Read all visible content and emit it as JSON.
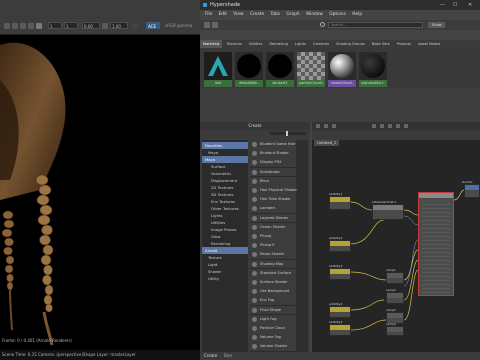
{
  "viewport": {
    "size_w": "1",
    "size_h": "1",
    "exposure": "0.00",
    "gamma": "1.00",
    "aces_badge": "ACE",
    "colorspace": "sRGB gamma",
    "footer_status": "Frame: 0 / 0.401   (Arnold Renderer)",
    "footer_camera": "Scene Time: 6.15   Camera: (perspective)Shape   Layer: masterLayer"
  },
  "hypershade": {
    "title": "Hypershade",
    "menus": [
      "File",
      "Edit",
      "View",
      "Create",
      "Tabs",
      "Graph",
      "Window",
      "Options",
      "Help"
    ],
    "search_placeholder": "Search...",
    "show_button": "Show",
    "browser_tabs": [
      "Materials",
      "Textures",
      "Utilities",
      "Rendering",
      "Lights",
      "Cameras",
      "Shading Groups",
      "Bake Sets",
      "Projects",
      "Asset Nodes"
    ],
    "swatches": [
      {
        "label": "Hair",
        "icon": "arnold-logo-icon",
        "color": "#2aa6b3"
      },
      {
        "label": "defaultMat..",
        "icon": "black-sphere-icon",
        "color": "#000000"
      },
      {
        "label": "lambert1",
        "icon": "black-sphere-icon",
        "color": "#000000"
      },
      {
        "label": "particleCloud1",
        "icon": "checker-icon",
        "color": "#888888"
      },
      {
        "label": "shaderGlow1",
        "icon": "glow-sphere-icon",
        "color": "#bfbfbf"
      },
      {
        "label": "standardSurf..",
        "icon": "dark-sphere-icon",
        "color": "#1a1a1a"
      }
    ],
    "create": {
      "title": "Create",
      "tree": [
        {
          "label": "Favorites",
          "group": true
        },
        {
          "label": "Maya",
          "group": false,
          "indent": 1
        },
        {
          "label": "Maya",
          "group": true
        },
        {
          "label": "Surface",
          "group": false,
          "indent": 2
        },
        {
          "label": "Volumetric",
          "group": false,
          "indent": 2
        },
        {
          "label": "Displacement",
          "group": false,
          "indent": 2
        },
        {
          "label": "2D Textures",
          "group": false,
          "indent": 2
        },
        {
          "label": "3D Textures",
          "group": false,
          "indent": 2
        },
        {
          "label": "Env Textures",
          "group": false,
          "indent": 2
        },
        {
          "label": "Other Textures",
          "group": false,
          "indent": 2
        },
        {
          "label": "Lights",
          "group": false,
          "indent": 2
        },
        {
          "label": "Utilities",
          "group": false,
          "indent": 2
        },
        {
          "label": "Image Planes",
          "group": false,
          "indent": 2
        },
        {
          "label": "Glow",
          "group": false,
          "indent": 2
        },
        {
          "label": "Rendering",
          "group": false,
          "indent": 2
        },
        {
          "label": "Arnold",
          "group": true
        },
        {
          "label": "Texture",
          "group": false,
          "indent": 1
        },
        {
          "label": "Light",
          "group": false,
          "indent": 1
        },
        {
          "label": "Shader",
          "group": false,
          "indent": 1
        },
        {
          "label": "Utility",
          "group": false,
          "indent": 1
        }
      ],
      "items": [
        "Bluebird Game Hair",
        "Bluebird Shader",
        "Display FRX",
        "Anisotropic",
        "Blinn",
        "Hair Physical Shader",
        "Hair Tube Shader",
        "Lambert",
        "Layered Shader",
        "Ocean Shader",
        "Phong",
        "Phong E",
        "Ramp Shader",
        "Shading Map",
        "Standard Surface",
        "Surface Shader",
        "Use Background",
        "Env Fog",
        "Fluid Shape",
        "Light Fog",
        "Particle Cloud",
        "Volume Fog",
        "Volume Shader"
      ]
    },
    "graph": {
      "tab_label": "Untitled_1",
      "node_labels": [
        "aiUtility1",
        "aiUtility2",
        "aiUtility3",
        "aiUtility4",
        "aiUtility5",
        "aiStandardHair1",
        "ramp1",
        "ramp2",
        "ramp3",
        "ramp4",
        "HairSG"
      ]
    },
    "bottom_tabs": [
      "Create",
      "Bins"
    ]
  }
}
